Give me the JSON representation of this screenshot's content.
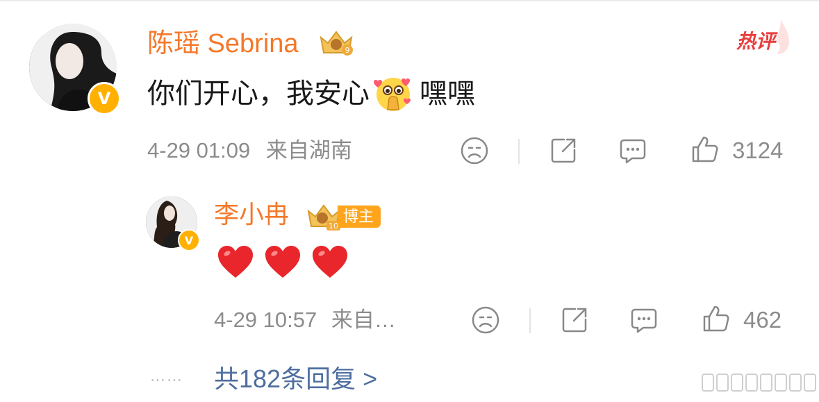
{
  "comment": {
    "username": "陈瑶 Sebrina",
    "level_badge": "crown-level-9",
    "hot_label": "热评",
    "text_before_emoji": "你们开心，我安心",
    "emoji": "pray-face-emoji",
    "text_after_emoji": "嘿嘿",
    "date": "4-29 01:09",
    "location": "来自湖南",
    "like_count": "3124"
  },
  "reply": {
    "username": "李小冉",
    "level_badge": "crown-level-10",
    "blogger_tag": "博主",
    "hearts": [
      "❤",
      "❤",
      "❤"
    ],
    "date": "4-29 10:57",
    "location": "来自…",
    "like_count": "462"
  },
  "more": {
    "dots": "……",
    "label": "共182条回复 >"
  },
  "colors": {
    "username": "#f5782a",
    "hot_label": "#e83e3e",
    "meta_gray": "#8c8c8c",
    "link_blue": "#4e6e9e",
    "verified_badge": "#ffb000"
  }
}
